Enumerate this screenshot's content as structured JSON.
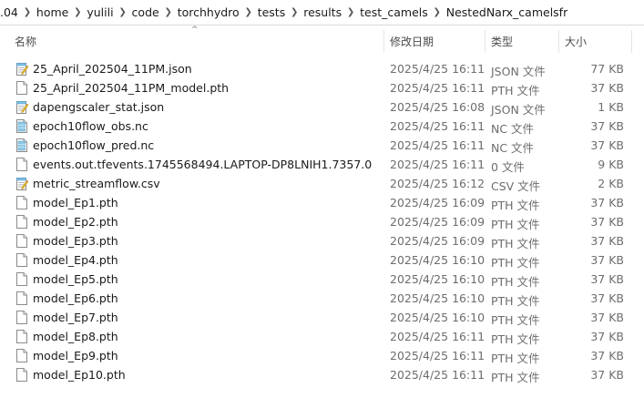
{
  "breadcrumb": [
    ".04",
    "home",
    "yulili",
    "code",
    "torchhydro",
    "tests",
    "results",
    "test_camels",
    "NestedNarx_camelsfr"
  ],
  "columns": {
    "name": "名称",
    "date": "修改日期",
    "type": "类型",
    "size": "大小"
  },
  "sort_indicator": "^",
  "files": [
    {
      "name": "25_April_202504_11PM.json",
      "date": "2025/4/25 16:11",
      "type": "JSON 文件",
      "size": "77 KB",
      "icon": "notepad-file-icon"
    },
    {
      "name": "25_April_202504_11PM_model.pth",
      "date": "2025/4/25 16:11",
      "type": "PTH 文件",
      "size": "37 KB",
      "icon": "blank-file-icon"
    },
    {
      "name": "dapengscaler_stat.json",
      "date": "2025/4/25 16:08",
      "type": "JSON 文件",
      "size": "1 KB",
      "icon": "notepad-file-icon"
    },
    {
      "name": "epoch10flow_obs.nc",
      "date": "2025/4/25 16:11",
      "type": "NC 文件",
      "size": "37 KB",
      "icon": "nc-file-icon"
    },
    {
      "name": "epoch10flow_pred.nc",
      "date": "2025/4/25 16:11",
      "type": "NC 文件",
      "size": "37 KB",
      "icon": "nc-file-icon"
    },
    {
      "name": "events.out.tfevents.1745568494.LAPTOP-DP8LNIH1.7357.0",
      "date": "2025/4/25 16:11",
      "type": "0 文件",
      "size": "9 KB",
      "icon": "blank-file-icon"
    },
    {
      "name": "metric_streamflow.csv",
      "date": "2025/4/25 16:12",
      "type": "CSV 文件",
      "size": "2 KB",
      "icon": "notepad-file-icon"
    },
    {
      "name": "model_Ep1.pth",
      "date": "2025/4/25 16:09",
      "type": "PTH 文件",
      "size": "37 KB",
      "icon": "blank-file-icon"
    },
    {
      "name": "model_Ep2.pth",
      "date": "2025/4/25 16:09",
      "type": "PTH 文件",
      "size": "37 KB",
      "icon": "blank-file-icon"
    },
    {
      "name": "model_Ep3.pth",
      "date": "2025/4/25 16:09",
      "type": "PTH 文件",
      "size": "37 KB",
      "icon": "blank-file-icon"
    },
    {
      "name": "model_Ep4.pth",
      "date": "2025/4/25 16:10",
      "type": "PTH 文件",
      "size": "37 KB",
      "icon": "blank-file-icon"
    },
    {
      "name": "model_Ep5.pth",
      "date": "2025/4/25 16:10",
      "type": "PTH 文件",
      "size": "37 KB",
      "icon": "blank-file-icon"
    },
    {
      "name": "model_Ep6.pth",
      "date": "2025/4/25 16:10",
      "type": "PTH 文件",
      "size": "37 KB",
      "icon": "blank-file-icon"
    },
    {
      "name": "model_Ep7.pth",
      "date": "2025/4/25 16:10",
      "type": "PTH 文件",
      "size": "37 KB",
      "icon": "blank-file-icon"
    },
    {
      "name": "model_Ep8.pth",
      "date": "2025/4/25 16:11",
      "type": "PTH 文件",
      "size": "37 KB",
      "icon": "blank-file-icon"
    },
    {
      "name": "model_Ep9.pth",
      "date": "2025/4/25 16:11",
      "type": "PTH 文件",
      "size": "37 KB",
      "icon": "blank-file-icon"
    },
    {
      "name": "model_Ep10.pth",
      "date": "2025/4/25 16:11",
      "type": "PTH 文件",
      "size": "37 KB",
      "icon": "blank-file-icon"
    }
  ]
}
